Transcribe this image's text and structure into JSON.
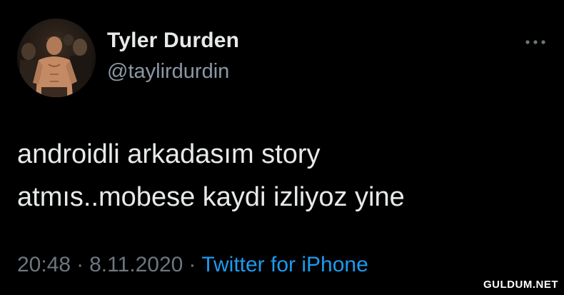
{
  "user": {
    "display_name": "Tyler Durden",
    "handle": "@taylirdurdin",
    "avatar_icon": "profile-photo"
  },
  "tweet": {
    "text_lines": [
      "androidli arkadasım story",
      "atmıs..mobese kaydi izliyoz yine"
    ],
    "time": "20:48",
    "separator": "·",
    "date": "8.11.2020",
    "source": "Twitter for iPhone"
  },
  "more_icon": "ellipsis-icon",
  "watermark": "GULDUM.NET",
  "colors": {
    "background": "#000000",
    "text": "#e7e9ea",
    "secondary": "#8b98a5",
    "link": "#1d9bf0"
  }
}
